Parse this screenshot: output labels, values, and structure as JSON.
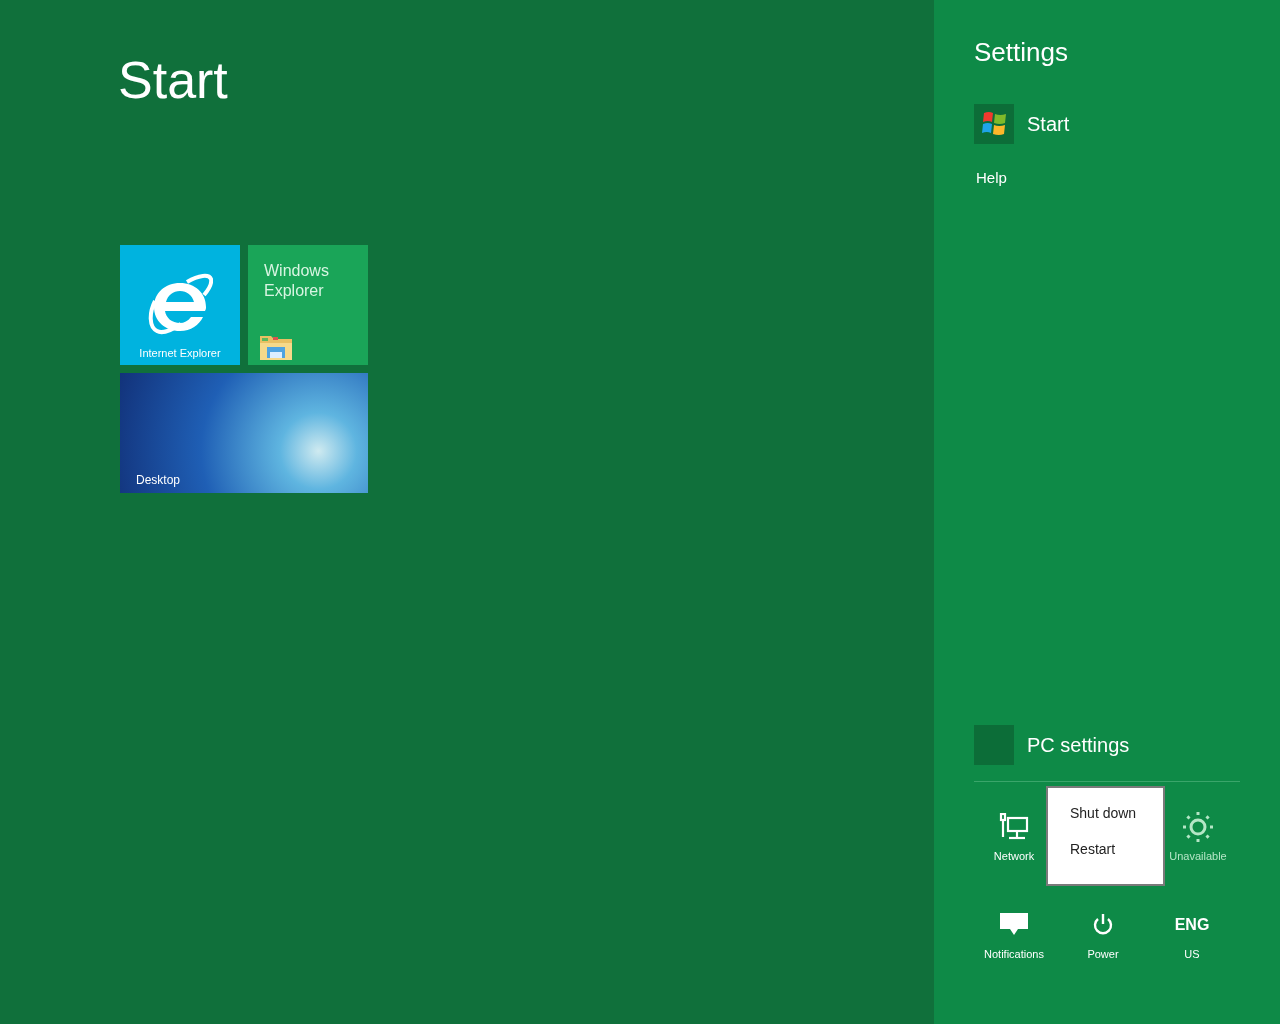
{
  "start_screen": {
    "title": "Start",
    "tiles": [
      {
        "kind": "app",
        "label": "Internet Explorer",
        "color": "#00b3df",
        "wide": false
      },
      {
        "kind": "folder",
        "label": "Windows Explorer",
        "color": "#1aa558",
        "wide": false
      },
      {
        "kind": "wallpaper",
        "label": "Desktop",
        "color": "#1f5fb5",
        "wide": true
      }
    ]
  },
  "settings_pane": {
    "title": "Settings",
    "app": {
      "name": "Start"
    },
    "links": [
      "Help"
    ],
    "pc_settings": "PC settings",
    "quick_settings": [
      {
        "kind": "network",
        "label": "Network",
        "disabled": false
      },
      {
        "kind": "brightness",
        "label": "Unavailable",
        "disabled": true
      },
      {
        "kind": "notifications",
        "label": "Notifications",
        "disabled": false
      },
      {
        "kind": "power",
        "label": "Power",
        "disabled": false
      },
      {
        "kind": "keyboard",
        "title": "ENG",
        "label": "US",
        "disabled": false
      }
    ],
    "power_menu": {
      "items": [
        "Shut down",
        "Restart"
      ]
    }
  }
}
